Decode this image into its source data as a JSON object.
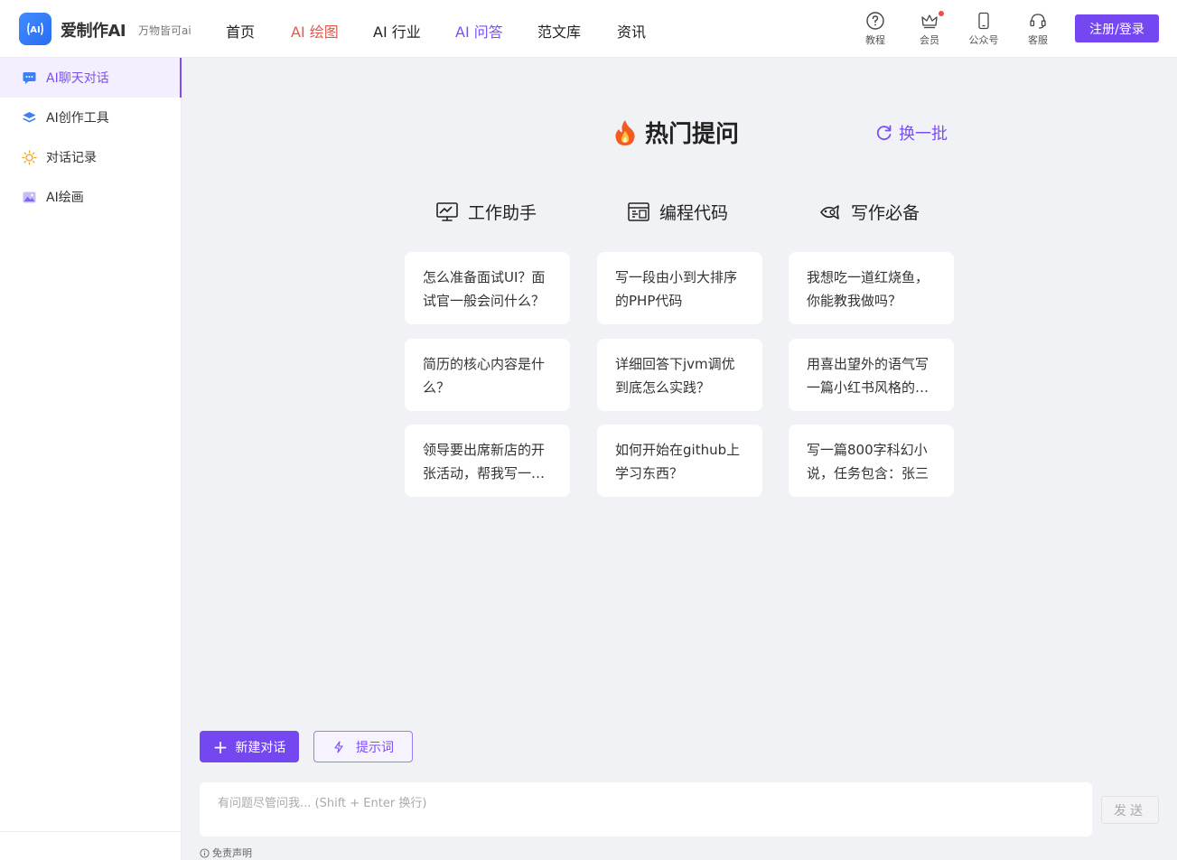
{
  "header": {
    "logo_text": "AI",
    "brand": "爱制作AI",
    "slogan": "万物皆可ai",
    "nav": [
      "首页",
      "AI 绘图",
      "AI 行业",
      "AI 问答",
      "范文库",
      "资讯"
    ],
    "tools": [
      {
        "label": "教程",
        "icon": "help-circle-icon"
      },
      {
        "label": "会员",
        "icon": "crown-icon"
      },
      {
        "label": "公众号",
        "icon": "phone-icon"
      },
      {
        "label": "客服",
        "icon": "headset-icon"
      }
    ],
    "login_label": "注册/登录"
  },
  "sidebar": {
    "items": [
      {
        "label": "AI聊天对话",
        "icon": "chat-icon",
        "active": true
      },
      {
        "label": "AI创作工具",
        "icon": "layers-icon"
      },
      {
        "label": "对话记录",
        "icon": "sun-icon"
      },
      {
        "label": "AI绘画",
        "icon": "image-icon"
      }
    ]
  },
  "main": {
    "hot_title": "热门提问",
    "refresh_label": "换一批",
    "categories": [
      {
        "name": "工作助手",
        "icon": "monitor-icon",
        "questions": [
          "怎么准备面试UI？面试官一般会问什么？",
          "简历的核心内容是什么？",
          "领导要出席新店的开张活动，帮我写一篇发言稿"
        ]
      },
      {
        "name": "编程代码",
        "icon": "code-icon",
        "questions": [
          "写一段由小到大排序的PHP代码",
          "详细回答下jvm调优到底怎么实践？",
          "如何开始在github上学习东西？"
        ]
      },
      {
        "name": "写作必备",
        "icon": "fish-icon",
        "questions": [
          "我想吃一道红烧鱼，你能教我做吗？",
          "用喜出望外的语气写一篇小红书风格的文案",
          "写一篇800字科幻小说，任务包含：张三"
        ]
      }
    ]
  },
  "footer": {
    "new_chat_label": "新建对话",
    "prompt_label": "提示词",
    "input_placeholder": "有问题尽管问我... (Shift + Enter 换行)",
    "send_label": "发送",
    "disclaimer": "免责声明"
  },
  "colors": {
    "accent": "#7447f1",
    "nav_red": "#e4584c",
    "background": "#f1f2f6"
  }
}
